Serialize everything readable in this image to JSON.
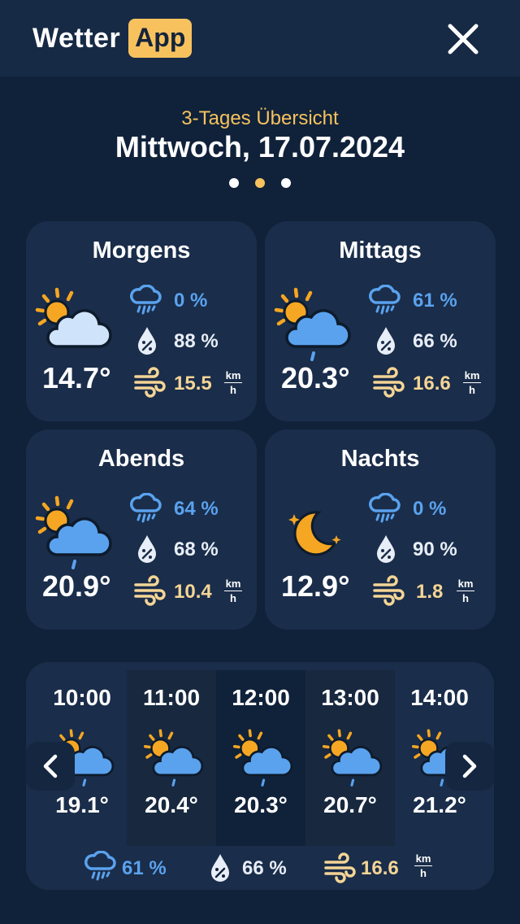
{
  "header": {
    "logo_text": "Wetter",
    "logo_badge": "App",
    "close_icon": "close-icon"
  },
  "overview": {
    "subtitle": "3-Tages Übersicht",
    "date": "Mittwoch, 17.07.2024"
  },
  "pagination": {
    "active_index": 1,
    "count": 3
  },
  "periods": [
    {
      "title": "Morgens",
      "icon": "sun-cloud-icon",
      "temp": "14.7°",
      "rain": "0 %",
      "humidity": "88 %",
      "wind": "15.5"
    },
    {
      "title": "Mittags",
      "icon": "sun-cloud-rain-icon",
      "temp": "20.3°",
      "rain": "61 %",
      "humidity": "66 %",
      "wind": "16.6"
    },
    {
      "title": "Abends",
      "icon": "sun-cloud-rain-icon",
      "temp": "20.9°",
      "rain": "64 %",
      "humidity": "68 %",
      "wind": "10.4"
    },
    {
      "title": "Nachts",
      "icon": "moon-stars-icon",
      "temp": "12.9°",
      "rain": "0 %",
      "humidity": "90 %",
      "wind": "1.8"
    }
  ],
  "units": {
    "wind_top": "km",
    "wind_bottom": "h"
  },
  "hourly": {
    "hours": [
      {
        "time": "10:00",
        "temp": "19.1°",
        "icon": "sun-cloud-rain-icon"
      },
      {
        "time": "11:00",
        "temp": "20.4°",
        "icon": "sun-cloud-rain-icon"
      },
      {
        "time": "12:00",
        "temp": "20.3°",
        "icon": "sun-cloud-rain-icon"
      },
      {
        "time": "13:00",
        "temp": "20.7°",
        "icon": "sun-cloud-rain-icon"
      },
      {
        "time": "14:00",
        "temp": "21.2°",
        "icon": "sun-cloud-rain-icon"
      }
    ],
    "selected_index": 2,
    "rain": "61 %",
    "humidity": "66 %",
    "wind": "16.6"
  },
  "colors": {
    "background": "#10223a",
    "card": "#1a2d4a",
    "accent": "#f7c25e",
    "blue": "#5aa2ee",
    "wind": "#f4d596"
  }
}
